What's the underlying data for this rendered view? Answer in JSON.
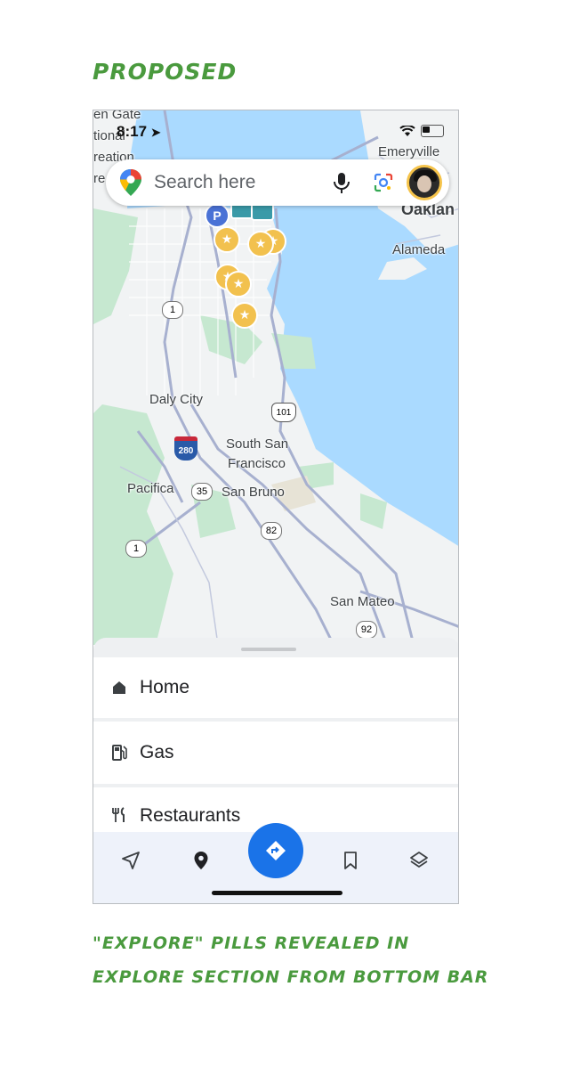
{
  "annotation": {
    "title": "Proposed",
    "caption_line1": "\"Explore\" pills revealed in",
    "caption_line2": "Explore section from bottom bar"
  },
  "status_bar": {
    "time": "8:17"
  },
  "search": {
    "placeholder": "Search here"
  },
  "map": {
    "labels": {
      "golden_gate": "en Gate",
      "national": "tional",
      "recreation": "reation",
      "re": "re",
      "emeryville": "Emeryville",
      "oakland": "Oaklan",
      "alameda": "Alameda",
      "daly_city": "Daly City",
      "south_san_francisco_1": "South San",
      "south_san_francisco_2": "Francisco",
      "pacifica": "Pacifica",
      "san_bruno": "San Bruno",
      "san_mateo": "San Mateo"
    },
    "shields": {
      "r1_top": "1",
      "r1_bottom": "1",
      "us101": "101",
      "i280": "280",
      "r35": "35",
      "r82": "82",
      "r92": "92"
    },
    "colors": {
      "water": "#aadaff",
      "land": "#f1f3f4",
      "park": "#c6e8d0",
      "road": "#a7b0cf",
      "star": "#f2c14e"
    }
  },
  "explore": {
    "items": [
      {
        "label": "Home",
        "icon": "home-icon"
      },
      {
        "label": "Gas",
        "icon": "gas-station-icon"
      },
      {
        "label": "Restaurants",
        "icon": "restaurant-icon"
      }
    ]
  },
  "bottom_nav": {
    "items": [
      "navigate-icon",
      "pin-icon",
      "directions-icon",
      "bookmark-icon",
      "layers-icon"
    ],
    "accent": "#1a73e8"
  }
}
